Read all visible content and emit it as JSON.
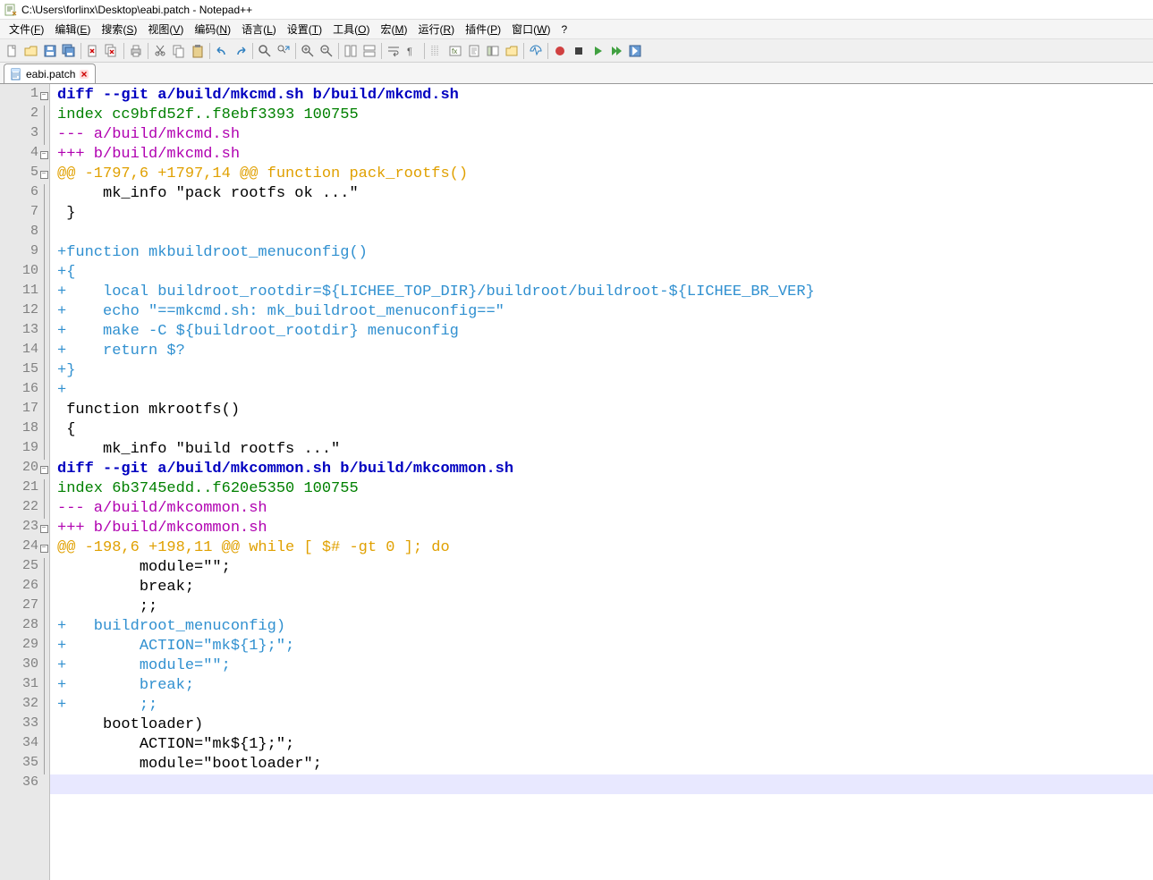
{
  "title": "C:\\Users\\forlinx\\Desktop\\eabi.patch - Notepad++",
  "menu": {
    "items": [
      {
        "label": "文件",
        "accel": "F"
      },
      {
        "label": "编辑",
        "accel": "E"
      },
      {
        "label": "搜索",
        "accel": "S"
      },
      {
        "label": "视图",
        "accel": "V"
      },
      {
        "label": "编码",
        "accel": "N"
      },
      {
        "label": "语言",
        "accel": "L"
      },
      {
        "label": "设置",
        "accel": "T"
      },
      {
        "label": "工具",
        "accel": "O"
      },
      {
        "label": "宏",
        "accel": "M"
      },
      {
        "label": "运行",
        "accel": "R"
      },
      {
        "label": "插件",
        "accel": "P"
      },
      {
        "label": "窗口",
        "accel": "W"
      },
      {
        "label": "?"
      }
    ]
  },
  "tab": {
    "name": "eabi.patch"
  },
  "code_lines": [
    {
      "n": 1,
      "fold": "open",
      "cls": "tok-diff",
      "t": "diff --git a/build/mkcmd.sh b/build/mkcmd.sh"
    },
    {
      "n": 2,
      "fold": "line",
      "cls": "tok-index",
      "t": "index cc9bfd52f..f8ebf3393 100755"
    },
    {
      "n": 3,
      "fold": "line",
      "cls": "tok-minus-h",
      "t": "--- a/build/mkcmd.sh"
    },
    {
      "n": 4,
      "fold": "open",
      "cls": "tok-plus-h",
      "t": "+++ b/build/mkcmd.sh"
    },
    {
      "n": 5,
      "fold": "open",
      "cls": "tok-hunk",
      "t": "@@ -1797,6 +1797,14 @@ function pack_rootfs()"
    },
    {
      "n": 6,
      "fold": "line",
      "cls": "tok-ctx",
      "t": "     mk_info \"pack rootfs ok ...\""
    },
    {
      "n": 7,
      "fold": "line",
      "cls": "tok-ctx",
      "t": " }"
    },
    {
      "n": 8,
      "fold": "line",
      "cls": "tok-ctx",
      "t": ""
    },
    {
      "n": 9,
      "fold": "line",
      "cls": "tok-add",
      "t": "+function mkbuildroot_menuconfig()"
    },
    {
      "n": 10,
      "fold": "line",
      "cls": "tok-add",
      "t": "+{"
    },
    {
      "n": 11,
      "fold": "line",
      "cls": "tok-add",
      "t": "+    local buildroot_rootdir=${LICHEE_TOP_DIR}/buildroot/buildroot-${LICHEE_BR_VER}"
    },
    {
      "n": 12,
      "fold": "line",
      "cls": "tok-add",
      "t": "+    echo \"==mkcmd.sh: mk_buildroot_menuconfig==\""
    },
    {
      "n": 13,
      "fold": "line",
      "cls": "tok-add",
      "t": "+    make -C ${buildroot_rootdir} menuconfig"
    },
    {
      "n": 14,
      "fold": "line",
      "cls": "tok-add",
      "t": "+    return $?"
    },
    {
      "n": 15,
      "fold": "line",
      "cls": "tok-add",
      "t": "+}"
    },
    {
      "n": 16,
      "fold": "line",
      "cls": "tok-add",
      "t": "+"
    },
    {
      "n": 17,
      "fold": "line",
      "cls": "tok-ctx",
      "t": " function mkrootfs()"
    },
    {
      "n": 18,
      "fold": "line",
      "cls": "tok-ctx",
      "t": " {"
    },
    {
      "n": 19,
      "fold": "line",
      "cls": "tok-ctx",
      "t": "     mk_info \"build rootfs ...\""
    },
    {
      "n": 20,
      "fold": "open",
      "cls": "tok-diff",
      "t": "diff --git a/build/mkcommon.sh b/build/mkcommon.sh"
    },
    {
      "n": 21,
      "fold": "line",
      "cls": "tok-index",
      "t": "index 6b3745edd..f620e5350 100755"
    },
    {
      "n": 22,
      "fold": "line",
      "cls": "tok-minus-h",
      "t": "--- a/build/mkcommon.sh"
    },
    {
      "n": 23,
      "fold": "open",
      "cls": "tok-plus-h",
      "t": "+++ b/build/mkcommon.sh"
    },
    {
      "n": 24,
      "fold": "open",
      "cls": "tok-hunk",
      "t": "@@ -198,6 +198,11 @@ while [ $# -gt 0 ]; do"
    },
    {
      "n": 25,
      "fold": "line",
      "cls": "tok-ctx",
      "t": "         module=\"\";"
    },
    {
      "n": 26,
      "fold": "line",
      "cls": "tok-ctx",
      "t": "         break;"
    },
    {
      "n": 27,
      "fold": "line",
      "cls": "tok-ctx",
      "t": "         ;;"
    },
    {
      "n": 28,
      "fold": "line",
      "cls": "tok-add",
      "t": "+   buildroot_menuconfig)"
    },
    {
      "n": 29,
      "fold": "line",
      "cls": "tok-add",
      "t": "+        ACTION=\"mk${1};\";"
    },
    {
      "n": 30,
      "fold": "line",
      "cls": "tok-add",
      "t": "+        module=\"\";"
    },
    {
      "n": 31,
      "fold": "line",
      "cls": "tok-add",
      "t": "+        break;"
    },
    {
      "n": 32,
      "fold": "line",
      "cls": "tok-add",
      "t": "+        ;;"
    },
    {
      "n": 33,
      "fold": "line",
      "cls": "tok-ctx",
      "t": "     bootloader)"
    },
    {
      "n": 34,
      "fold": "line",
      "cls": "tok-ctx",
      "t": "         ACTION=\"mk${1};\";"
    },
    {
      "n": 35,
      "fold": "line",
      "cls": "tok-ctx",
      "t": "         module=\"bootloader\";"
    },
    {
      "n": 36,
      "fold": "none",
      "cls": "tok-ctx",
      "t": "",
      "current": true
    }
  ],
  "toolbar_buttons": [
    "new-file",
    "open-file",
    "save-file",
    "save-all",
    "sep",
    "close-file",
    "close-all",
    "sep",
    "print",
    "sep",
    "cut",
    "copy",
    "paste",
    "sep",
    "undo",
    "redo",
    "sep",
    "find",
    "replace",
    "sep",
    "zoom-in",
    "zoom-out",
    "sep",
    "sync-v",
    "sync-h",
    "sep",
    "wordwrap",
    "show-all",
    "sep",
    "indent-guides",
    "lang",
    "doc-map",
    "func-list",
    "folder",
    "sep",
    "monitor",
    "sep",
    "record-macro",
    "stop-macro",
    "play-macro",
    "play-multi",
    "save-macro"
  ]
}
